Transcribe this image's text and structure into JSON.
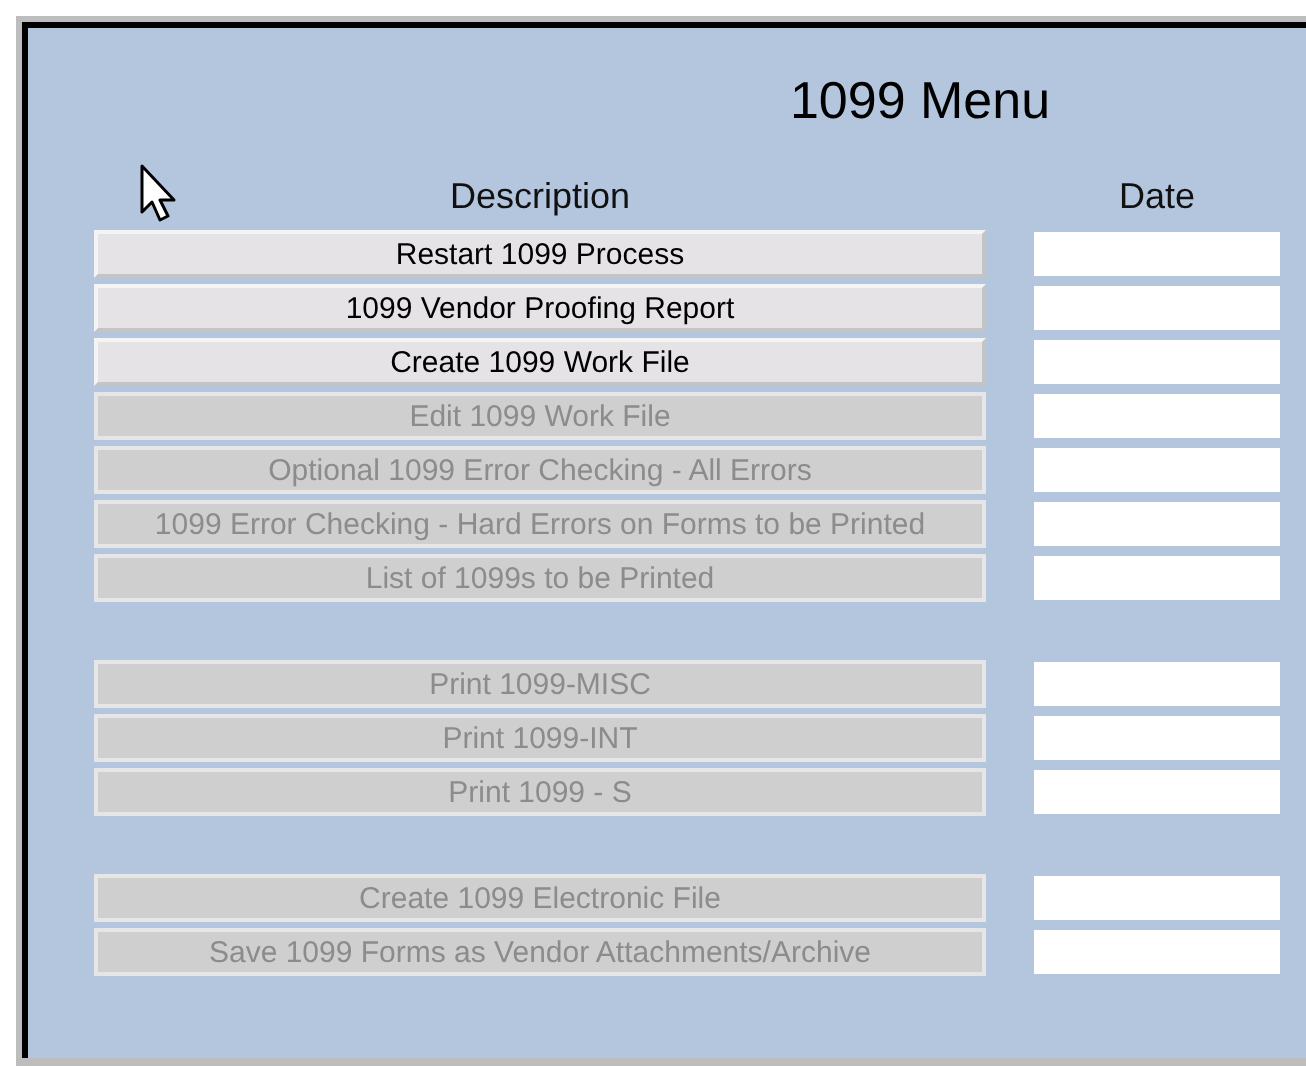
{
  "title": "1099 Menu",
  "columns": {
    "description": "Description",
    "date": "Date"
  },
  "groups": [
    {
      "items": [
        {
          "label": "Restart 1099 Process",
          "disabled": false
        },
        {
          "label": "1099 Vendor Proofing Report",
          "disabled": false
        },
        {
          "label": "Create 1099 Work File",
          "disabled": false
        },
        {
          "label": "Edit 1099 Work File",
          "disabled": true
        },
        {
          "label": "Optional 1099 Error Checking - All Errors",
          "disabled": true
        },
        {
          "label": "1099 Error Checking - Hard Errors on Forms to be Printed",
          "disabled": true
        },
        {
          "label": "List of 1099s to be Printed",
          "disabled": true
        }
      ]
    },
    {
      "items": [
        {
          "label": "Print 1099-MISC",
          "disabled": true
        },
        {
          "label": "Print 1099-INT",
          "disabled": true
        },
        {
          "label": "Print 1099 - S",
          "disabled": true
        }
      ]
    },
    {
      "items": [
        {
          "label": "Create 1099 Electronic File",
          "disabled": true
        },
        {
          "label": "Save 1099 Forms as Vendor Attachments/Archive",
          "disabled": true
        }
      ]
    }
  ]
}
